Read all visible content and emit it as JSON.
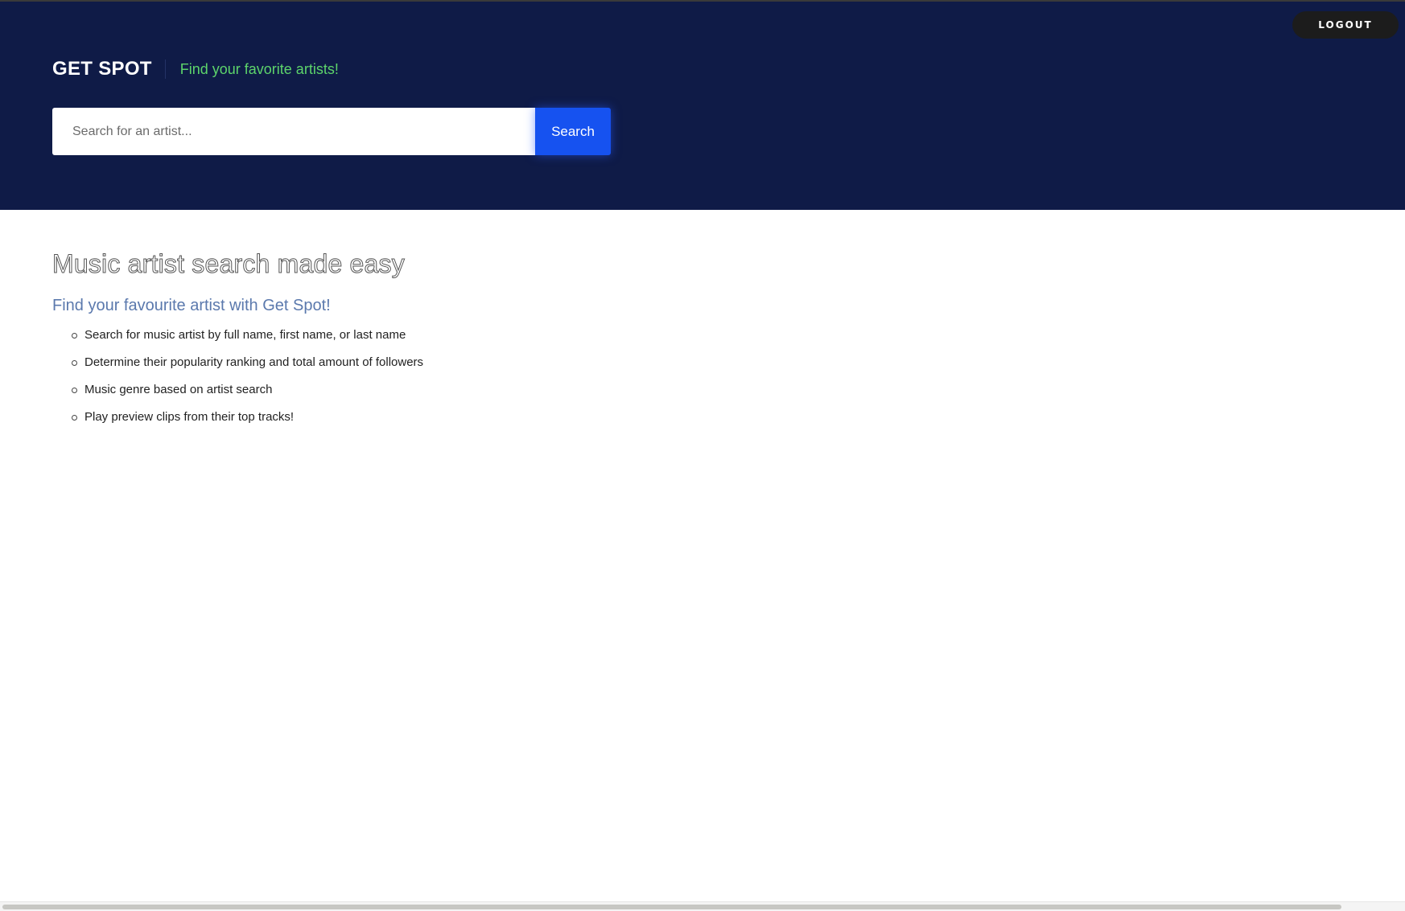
{
  "header": {
    "logout_label": "LOGOUT",
    "brand_title": "GET SPOT",
    "tagline": "Find your favorite artists!",
    "background_color": "#0f1b47",
    "tagline_color": "#5dd46b"
  },
  "search": {
    "placeholder": "Search for an artist...",
    "value": "",
    "button_label": "Search",
    "button_color": "#1652f0"
  },
  "main": {
    "headline": "Music artist search made easy",
    "subheadline": "Find your favourite artist with Get Spot!",
    "features": [
      "Search for music artist by full name, first name, or last name",
      "Determine their popularity ranking and total amount of followers",
      "Music genre based on artist search",
      "Play preview clips from their top tracks!"
    ]
  }
}
